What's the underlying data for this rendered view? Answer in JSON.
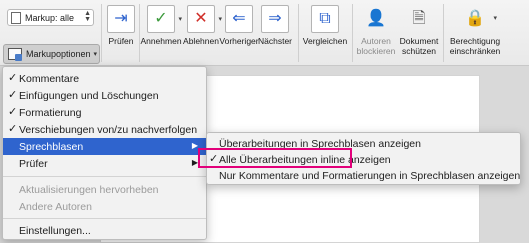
{
  "toolbar": {
    "markup_select_value": "Markup: alle",
    "markup_options_label": "Markupoptionen",
    "buttons": {
      "pruefen": "Prüfen",
      "annehmen": "Annehmen",
      "ablehnen": "Ablehnen",
      "vorheriger": "Vorheriger",
      "naechster": "Nächster",
      "vergleichen": "Vergleichen",
      "autoren_blockieren": "Autoren\nblockieren",
      "dokument_schuetzen": "Dokument\nschützen",
      "berechtigung": "Berechtigung\neinschränken"
    }
  },
  "menu": {
    "items": [
      {
        "label": "Kommentare",
        "checked": true
      },
      {
        "label": "Einfügungen und Löschungen",
        "checked": true
      },
      {
        "label": "Formatierung",
        "checked": true
      },
      {
        "label": "Verschiebungen von/zu nachverfolgen",
        "checked": true
      },
      {
        "label": "Sprechblasen",
        "highlighted": true
      },
      {
        "label": "Prüfer"
      },
      {
        "label": "Aktualisierungen hervorheben",
        "disabled": true
      },
      {
        "label": "Andere Autoren",
        "disabled": true
      },
      {
        "label": "Einstellungen..."
      }
    ],
    "check_glyph": "✓",
    "arrow_glyph": "▶"
  },
  "submenu": {
    "items": [
      {
        "label": "Überarbeitungen in Sprechblasen anzeigen"
      },
      {
        "label": "Alle Überarbeitungen inline anzeigen",
        "checked": true
      },
      {
        "label": "Nur Kommentare und Formatierungen in Sprechblasen anzeigen"
      }
    ]
  },
  "colors": {
    "menu_highlight": "#2f64ce",
    "callout_border": "#e2007a"
  }
}
